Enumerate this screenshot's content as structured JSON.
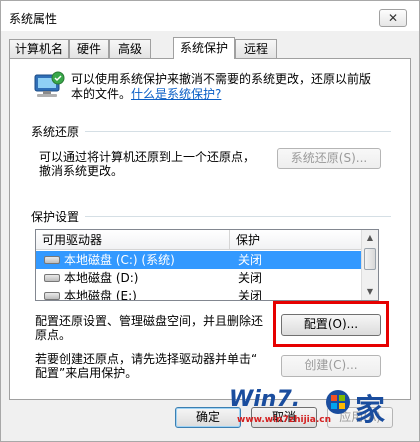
{
  "window": {
    "title": "系统属性",
    "close_glyph": "✕"
  },
  "tabs": [
    {
      "label": "计算机名"
    },
    {
      "label": "硬件"
    },
    {
      "label": "高级"
    },
    {
      "label": "系统保护",
      "active": true
    },
    {
      "label": "远程"
    }
  ],
  "intro": {
    "line1": "可以使用系统保护来撤消不需要的系统更改，还原以前版",
    "line2_text": "本的文件。",
    "link": "什么是系统保护?"
  },
  "system_restore": {
    "heading": "系统还原",
    "desc_line1": "可以通过将计算机还原到上一个还原点，",
    "desc_line2": "撤消系统更改。",
    "button": "系统还原(S)..."
  },
  "protection": {
    "heading": "保护设置",
    "columns": [
      "可用驱动器",
      "保护"
    ],
    "rows": [
      {
        "drive": "本地磁盘 (C:) (系统)",
        "status": "关闭",
        "selected": true
      },
      {
        "drive": "本地磁盘 (D:)",
        "status": "关闭",
        "selected": false
      },
      {
        "drive": "本地磁盘 (E:)",
        "status": "关闭",
        "selected": false
      }
    ],
    "configure_line1": "配置还原设置、管理磁盘空间，并且删除还",
    "configure_line2": "原点。",
    "configure_button": "配置(O)...",
    "create_line1": "若要创建还原点，请先选择驱动器并单击“",
    "create_line2": "配置”来启用保护。",
    "create_button": "创建(C)..."
  },
  "footer": {
    "ok": "确定",
    "cancel": "取消",
    "apply": "应用(A)"
  },
  "watermark": {
    "brand": "Win7.",
    "site": "www.win7zhijia.cn",
    "char": "家"
  },
  "colors": {
    "selection": "#3399ff",
    "link": "#0b5fc6",
    "highlight": "#e60000",
    "watermark": "#1a4d9e"
  }
}
